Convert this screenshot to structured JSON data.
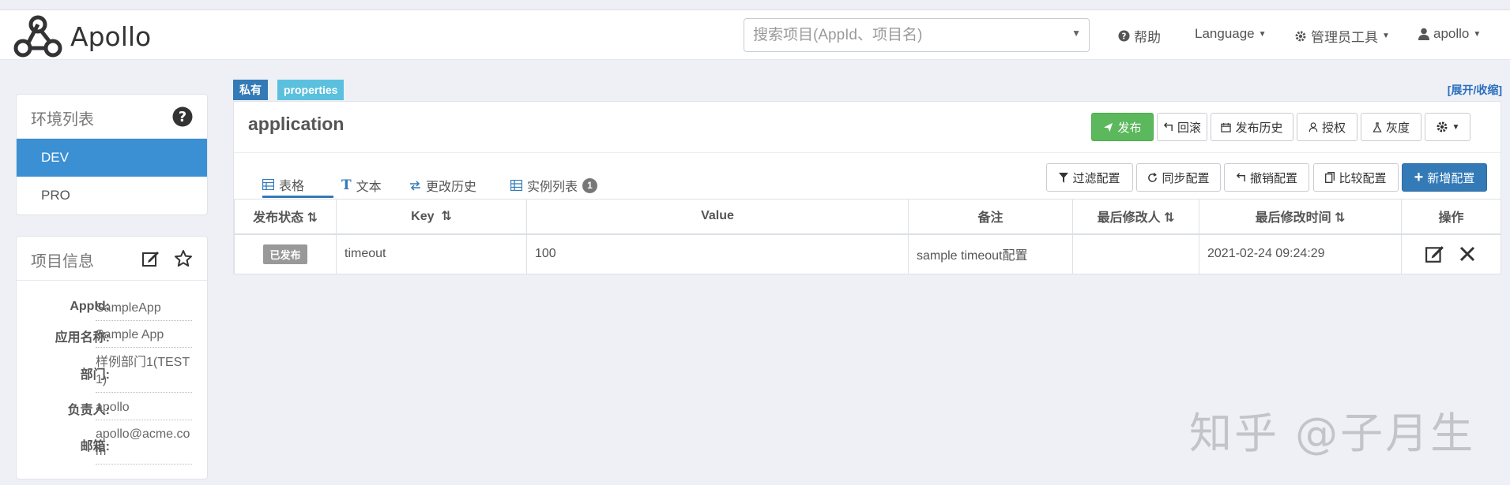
{
  "header": {
    "brand": "Apollo",
    "search_placeholder": "搜索项目(AppId、项目名)",
    "help": "帮助",
    "language": "Language",
    "admin_tools": "管理员工具",
    "user": "apollo"
  },
  "env_panel": {
    "title": "环境列表",
    "items": [
      "DEV",
      "PRO"
    ],
    "active": "DEV"
  },
  "project_panel": {
    "title": "项目信息",
    "rows": [
      {
        "label": "AppId:",
        "value": "SampleApp"
      },
      {
        "label": "应用名称:",
        "value": "Sample App"
      },
      {
        "label": "部门:",
        "value": "样例部门1(TEST1)"
      },
      {
        "label": "负责人:",
        "value": "apollo"
      },
      {
        "label": "邮箱:",
        "value": "apollo@acme.com"
      }
    ]
  },
  "namespace": {
    "tag_private": "私有",
    "tag_format": "properties",
    "expand_toggle": "[展开/收缩]",
    "title": "application"
  },
  "actions": {
    "publish": "发布",
    "rollback": "回滚",
    "history": "发布历史",
    "grant": "授权",
    "gray": "灰度"
  },
  "tabs": [
    {
      "label": "表格"
    },
    {
      "label": "文本"
    },
    {
      "label": "更改历史"
    },
    {
      "label": "实例列表",
      "badge": "1"
    }
  ],
  "toolbar": {
    "filter": "过滤配置",
    "sync": "同步配置",
    "revoke": "撤销配置",
    "compare": "比较配置",
    "add": "新增配置"
  },
  "table": {
    "columns": [
      "发布状态",
      "Key",
      "Value",
      "备注",
      "最后修改人",
      "最后修改时间",
      "操作"
    ],
    "rows": [
      {
        "status": "已发布",
        "key": "timeout",
        "value": "100",
        "comment": "sample timeout配置",
        "modifier": "",
        "modified_time": "2021-02-24 09:24:29"
      }
    ]
  },
  "watermark": "知乎 @子月生",
  "colors": {
    "primary": "#337ab7",
    "env_active": "#3b8fd3",
    "success": "#5cb85c",
    "tag_format": "#5bc0de",
    "tag_private": "#337ab7"
  }
}
